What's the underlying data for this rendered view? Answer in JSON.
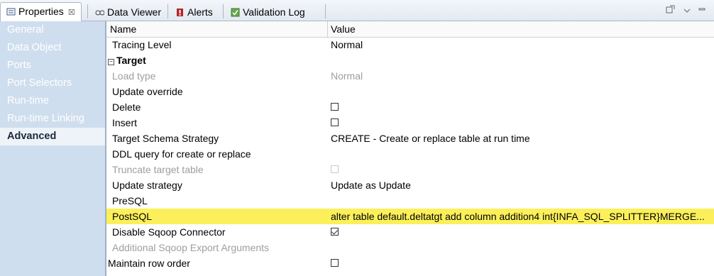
{
  "tabs": [
    {
      "label": "Properties",
      "close": "☒",
      "icon": "properties-icon"
    },
    {
      "label": "Data Viewer",
      "icon": "data-viewer-icon"
    },
    {
      "label": "Alerts",
      "icon": "alerts-icon"
    },
    {
      "label": "Validation Log",
      "icon": "validation-log-icon"
    }
  ],
  "sidebar": {
    "items": [
      {
        "label": "General"
      },
      {
        "label": "Data Object"
      },
      {
        "label": "Ports"
      },
      {
        "label": "Port Selectors"
      },
      {
        "label": "Run-time"
      },
      {
        "label": "Run-time Linking"
      },
      {
        "label": "Advanced"
      }
    ]
  },
  "grid": {
    "header": {
      "name": "Name",
      "value": "Value"
    },
    "rows": [
      {
        "name": "Tracing Level",
        "value": "Normal"
      },
      {
        "name": "Target",
        "toggle": "−"
      },
      {
        "name": "Load type",
        "value": "Normal"
      },
      {
        "name": "Update override",
        "value": ""
      },
      {
        "name": "Delete"
      },
      {
        "name": "Insert"
      },
      {
        "name": "Target Schema Strategy",
        "value": "CREATE - Create or replace table at run time"
      },
      {
        "name": "DDL query for create or replace",
        "value": ""
      },
      {
        "name": "Truncate target table"
      },
      {
        "name": "Update strategy",
        "value": "Update as Update"
      },
      {
        "name": "PreSQL",
        "value": ""
      },
      {
        "name": "PostSQL",
        "value": "alter table default.deltatgt add column addition4 int{INFA_SQL_SPLITTER}MERGE..."
      },
      {
        "name": "Disable Sqoop Connector"
      },
      {
        "name": "Additional Sqoop Export Arguments",
        "value": ""
      },
      {
        "name": "Maintain row order"
      }
    ]
  }
}
